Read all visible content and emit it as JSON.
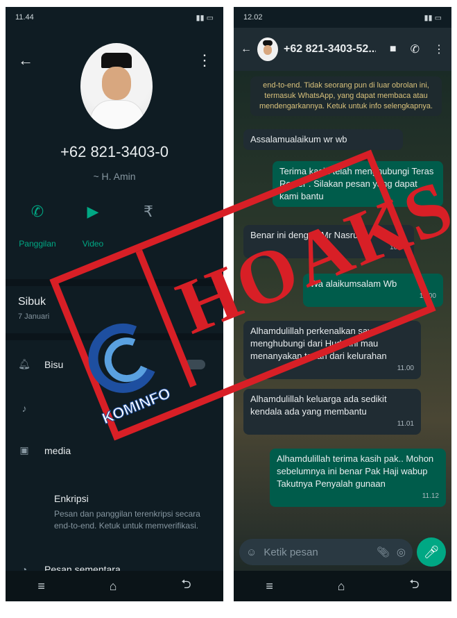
{
  "left": {
    "status_time": "11.44",
    "phone_number": "+62 821-3403-0",
    "alias": "~ H. Amin",
    "actions": [
      {
        "label": "Panggilan",
        "icon": "phone-icon"
      },
      {
        "label": "Video",
        "icon": "video-icon"
      },
      {
        "label": "",
        "icon": "money-icon"
      }
    ],
    "about_title": "Sibuk",
    "about_date": "7 Januari",
    "rows": [
      {
        "label": "Bisu",
        "icon": "bell-icon"
      },
      {
        "label": "",
        "icon": "music-note-icon"
      },
      {
        "label": "media",
        "icon": "image-icon"
      }
    ],
    "encryption_title": "Enkripsi",
    "encryption_body": "Pesan dan panggilan terenkripsi secara end-to-end. Ketuk untuk memverifikasi.",
    "disappearing_label": "Pesan sementara"
  },
  "right": {
    "status_time": "12.02",
    "header_number": "+62 821-3403-52...",
    "messages": [
      {
        "type": "sys",
        "text": "end-to-end. Tidak seorang pun di luar obrolan ini, termasuk WhatsApp, yang dapat membaca atau mendengarkannya. Ketuk untuk info selengkapnya."
      },
      {
        "type": "in",
        "text": "Assalamualaikum wr wb",
        "time": ""
      },
      {
        "type": "out",
        "text": "Terima kasih telah menghubungi Teras Roster . Silakan pesan yang dapat kami bantu",
        "time": ""
      },
      {
        "type": "in",
        "text": "Benar ini dengan Mr Nasrul",
        "time": "10.57"
      },
      {
        "type": "out",
        "text": "Wa alaikumsalam Wb",
        "time": "11.00"
      },
      {
        "type": "in",
        "text": "Alhamdulillah perkenalkan saya menghubungi dari Huda ini mau menanyakan tanah dari kelurahan",
        "time": "11.00"
      },
      {
        "type": "in",
        "text": "Alhamdulillah keluarga ada sedikit kendala ada yang membantu",
        "time": "11.01"
      },
      {
        "type": "out",
        "text": "Alhamdulillah terima kasih pak.. Mohon sebelumnya ini benar Pak Haji wabup  Takutnya Penyalah gunaan",
        "time": "11.12"
      }
    ],
    "composer_placeholder": "Ketik pesan"
  },
  "stamp": {
    "label": "HOAKS",
    "logo_text": "KOMINFO",
    "color": "#d81f26"
  }
}
